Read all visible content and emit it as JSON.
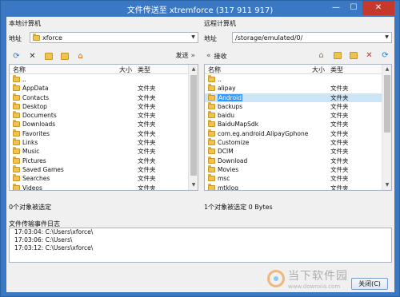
{
  "window": {
    "title": "文件传送至 xtremforce (317 911 917)",
    "minimize": "—",
    "maximize": "☐",
    "close": "✕"
  },
  "local": {
    "heading": "本地计算机",
    "address_label": "地址",
    "address_value": "xforce",
    "send_label": "发送",
    "columns": {
      "name": "名称",
      "size": "大小",
      "type": "类型"
    },
    "items": [
      {
        "name": "..",
        "type": ""
      },
      {
        "name": "AppData",
        "type": "文件夹"
      },
      {
        "name": "Contacts",
        "type": "文件夹"
      },
      {
        "name": "Desktop",
        "type": "文件夹"
      },
      {
        "name": "Documents",
        "type": "文件夹"
      },
      {
        "name": "Downloads",
        "type": "文件夹"
      },
      {
        "name": "Favorites",
        "type": "文件夹"
      },
      {
        "name": "Links",
        "type": "文件夹"
      },
      {
        "name": "Music",
        "type": "文件夹"
      },
      {
        "name": "Pictures",
        "type": "文件夹"
      },
      {
        "name": "Saved Games",
        "type": "文件夹"
      },
      {
        "name": "Searches",
        "type": "文件夹"
      },
      {
        "name": "Videos",
        "type": "文件夹"
      }
    ],
    "status": "0个对象被选定"
  },
  "remote": {
    "heading": "远程计算机",
    "address_label": "地址",
    "address_value": "/storage/emulated/0/",
    "receive_label": "接收",
    "columns": {
      "name": "名称",
      "size": "大小",
      "type": "类型"
    },
    "items": [
      {
        "name": "..",
        "type": ""
      },
      {
        "name": "alipay",
        "type": "文件夹"
      },
      {
        "name": "Android",
        "type": "文件夹",
        "selected": true
      },
      {
        "name": "backups",
        "type": "文件夹"
      },
      {
        "name": "baidu",
        "type": "文件夹"
      },
      {
        "name": "BaiduMapSdk",
        "type": "文件夹"
      },
      {
        "name": "com.eg.android.AlipayGphone",
        "type": "文件夹"
      },
      {
        "name": "Customize",
        "type": "文件夹"
      },
      {
        "name": "DCIM",
        "type": "文件夹"
      },
      {
        "name": "Download",
        "type": "文件夹"
      },
      {
        "name": "Movies",
        "type": "文件夹"
      },
      {
        "name": "msc",
        "type": "文件夹"
      },
      {
        "name": "mtklog",
        "type": "文件夹"
      }
    ],
    "status": "1个对象被选定 0 Bytes"
  },
  "log": {
    "heading": "文件传输事件日志",
    "lines": [
      "17:03:04: C:\\Users\\xforce\\",
      "17:03:06: C:\\Users\\",
      "17:03:12: C:\\Users\\xforce\\"
    ]
  },
  "close_button": "关闭(C)",
  "watermark": {
    "title": "当下软件园",
    "url": "www.downxia.com"
  },
  "colors": {
    "titlebar": "#3a78c3",
    "folder": "#f0c44c",
    "selection": "#3399ff",
    "close": "#c7382c"
  }
}
